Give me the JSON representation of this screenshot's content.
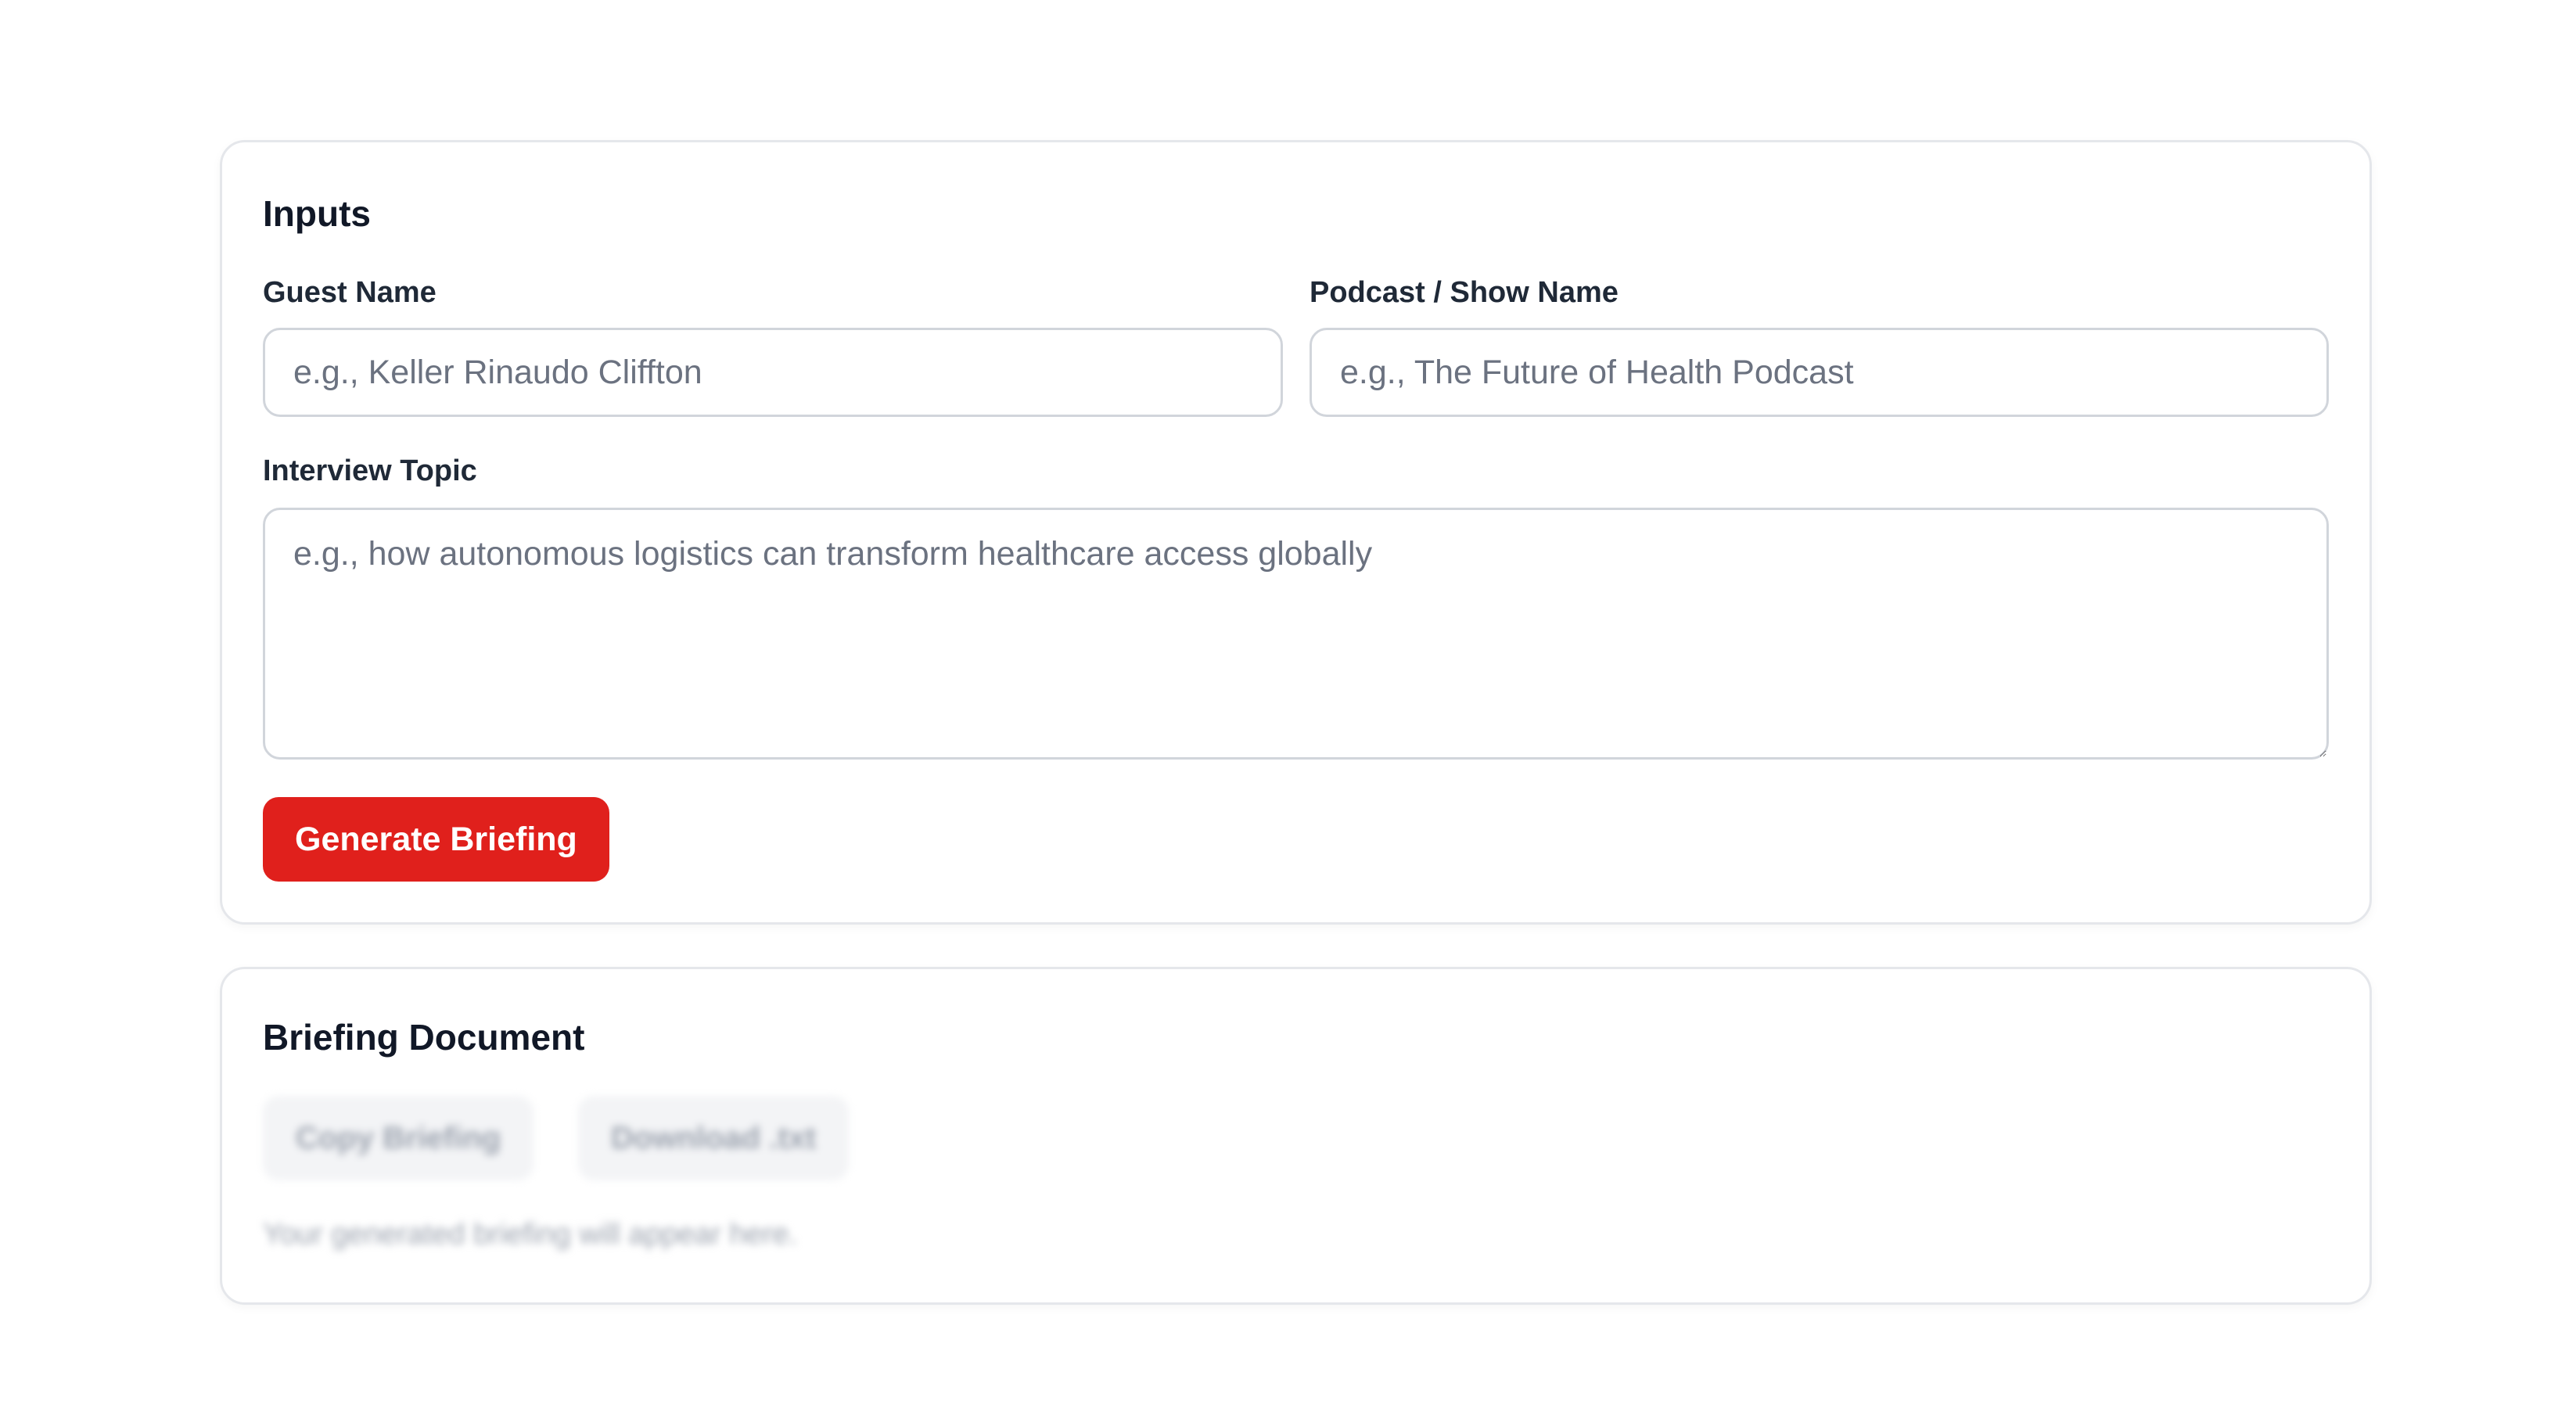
{
  "inputs_card": {
    "title": "Inputs",
    "guest_name": {
      "label": "Guest Name",
      "value": "",
      "placeholder": "e.g., Keller Rinaudo Cliffton"
    },
    "show_name": {
      "label": "Podcast / Show Name",
      "value": "",
      "placeholder": "e.g., The Future of Health Podcast"
    },
    "topic": {
      "label": "Interview Topic",
      "value": "",
      "placeholder": "e.g., how autonomous logistics can transform healthcare access globally"
    },
    "generate_label": "Generate Briefing"
  },
  "briefing_card": {
    "title": "Briefing Document",
    "copy_label": "Copy Briefing",
    "download_label": "Download .txt",
    "empty_message": "Your generated briefing will appear here."
  },
  "colors": {
    "primary": "#e0201c",
    "border": "#e5e7eb",
    "input_border": "#d1d5db",
    "muted_text": "#6b7280"
  }
}
